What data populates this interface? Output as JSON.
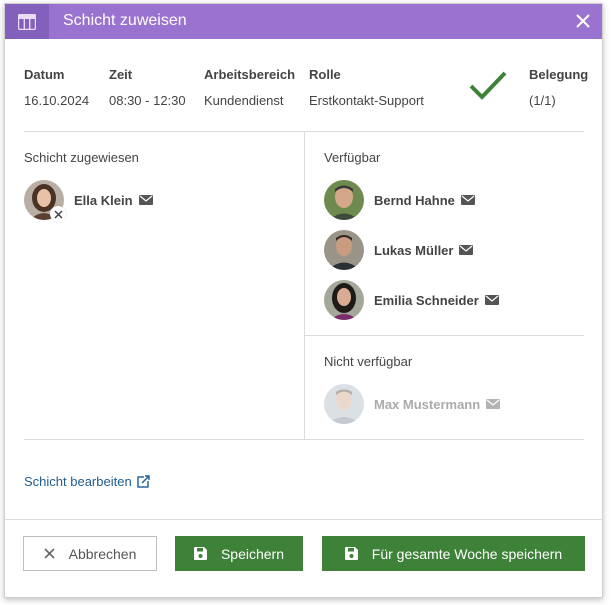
{
  "dialog": {
    "title": "Schicht zuweisen",
    "icon": "calendar-table-icon",
    "close_icon": "close-icon"
  },
  "info": {
    "date_label": "Datum",
    "date_value": "16.10.2024",
    "time_label": "Zeit",
    "time_value": "08:30 - 12:30",
    "area_label": "Arbeitsbereich",
    "area_value": "Kundendienst",
    "role_label": "Rolle",
    "role_value": "Erstkontakt-Support",
    "status_icon": "checkmark-icon",
    "occupancy_label": "Belegung",
    "occupancy_value": "(1/1)"
  },
  "assigned": {
    "label": "Schicht zugewiesen",
    "people": [
      {
        "name": "Ella Klein"
      }
    ]
  },
  "available": {
    "label": "Verfügbar",
    "people": [
      {
        "name": "Bernd Hahne"
      },
      {
        "name": "Lukas Müller"
      },
      {
        "name": "Emilia Schneider"
      }
    ]
  },
  "unavailable": {
    "label": "Nicht verfügbar",
    "people": [
      {
        "name": "Max Mustermann"
      }
    ]
  },
  "links": {
    "edit_shift": "Schicht bearbeiten"
  },
  "buttons": {
    "cancel": "Abbrechen",
    "save": "Speichern",
    "save_week": "Für gesamte Woche speichern"
  },
  "colors": {
    "header": "#9a72cf",
    "header_icon_bg": "#8460bd",
    "primary_button": "#3e8138",
    "check": "#3e8138",
    "link": "#1f5c8f"
  }
}
